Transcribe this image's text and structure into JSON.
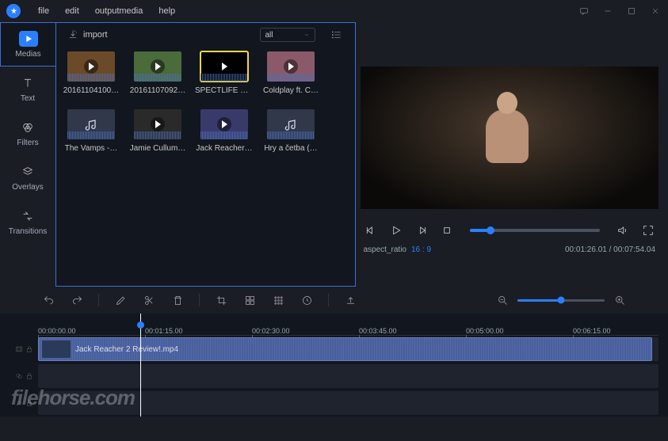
{
  "menu": {
    "file": "file",
    "edit": "edit",
    "outputmedia": "outputmedia",
    "help": "help"
  },
  "sidebar": {
    "items": [
      {
        "label": "Medias"
      },
      {
        "label": "Text"
      },
      {
        "label": "Filters"
      },
      {
        "label": "Overlays"
      },
      {
        "label": "Transitions"
      }
    ]
  },
  "media": {
    "import_label": "import",
    "filter_selected": "all",
    "thumbs": [
      {
        "label": "20161104100…",
        "kind": "video"
      },
      {
        "label": "20161107092…",
        "kind": "video"
      },
      {
        "label": "SPECTLIFE m…",
        "kind": "video-dark",
        "selected": true
      },
      {
        "label": "Coldplay ft. C…",
        "kind": "video"
      },
      {
        "label": "The Vamps -…",
        "kind": "audio"
      },
      {
        "label": "Jamie Cullum…",
        "kind": "video"
      },
      {
        "label": "Jack Reacher…",
        "kind": "video"
      },
      {
        "label": "Hry a četba (…",
        "kind": "audio"
      }
    ]
  },
  "preview": {
    "aspect_label": "aspect_ratio",
    "aspect_value": "16 : 9",
    "time_current": "00:01:26.01",
    "time_total": "00:07:54.04",
    "progress_pct": 16
  },
  "timeline": {
    "ticks": [
      "00:00:00.00",
      "00:01:15.00",
      "00:02:30.00",
      "00:03:45.00",
      "00:05:00.00",
      "00:06:15.00"
    ],
    "clip_label": "Jack Reacher 2 Review!.mp4",
    "playhead_pct": 19
  },
  "colors": {
    "accent": "#2b7fff",
    "panel_border": "#3a6fd8"
  },
  "watermark": "filehorse.com"
}
